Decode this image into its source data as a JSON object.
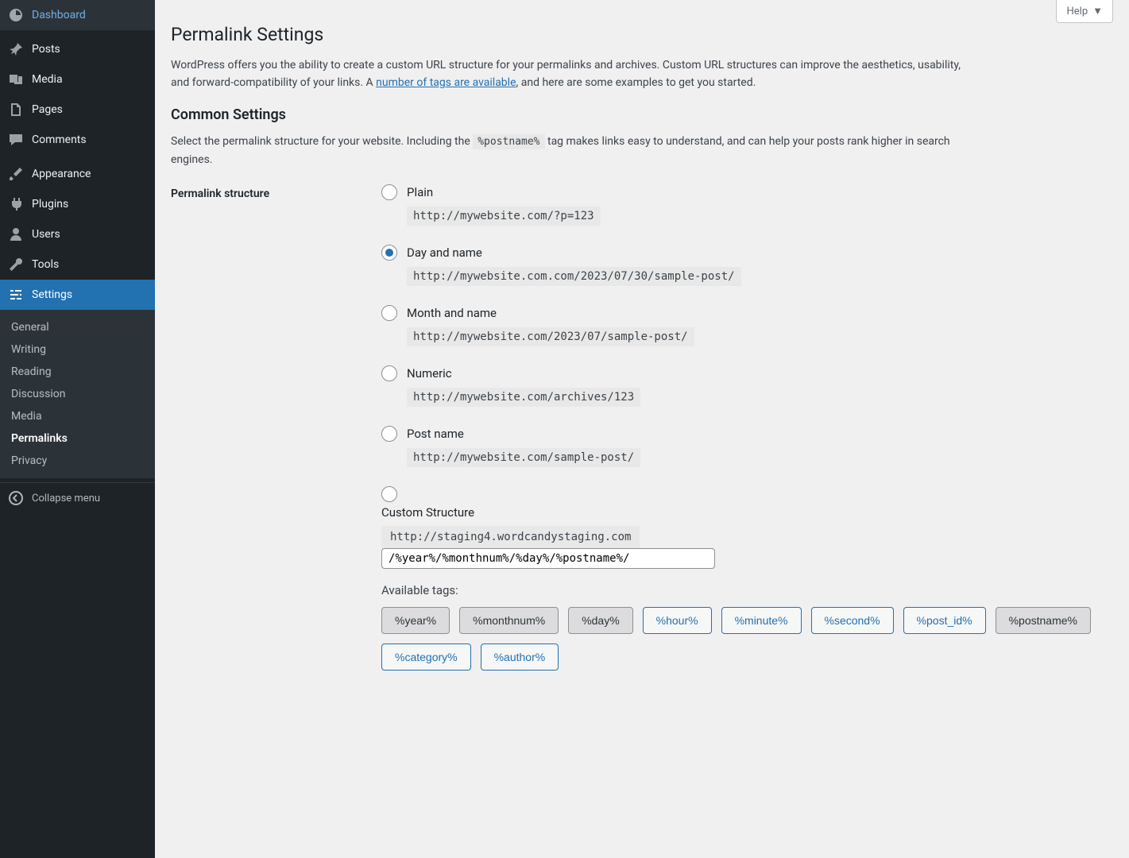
{
  "sidebar": {
    "items": [
      {
        "label": "Dashboard",
        "icon": "dashboard"
      },
      {
        "label": "Posts",
        "icon": "posts"
      },
      {
        "label": "Media",
        "icon": "media"
      },
      {
        "label": "Pages",
        "icon": "pages"
      },
      {
        "label": "Comments",
        "icon": "comments"
      },
      {
        "label": "Appearance",
        "icon": "appearance"
      },
      {
        "label": "Plugins",
        "icon": "plugins"
      },
      {
        "label": "Users",
        "icon": "users"
      },
      {
        "label": "Tools",
        "icon": "tools"
      },
      {
        "label": "Settings",
        "icon": "settings"
      }
    ],
    "submenu": [
      "General",
      "Writing",
      "Reading",
      "Discussion",
      "Media",
      "Permalinks",
      "Privacy"
    ],
    "collapse_label": "Collapse menu"
  },
  "help_label": "Help",
  "page_title": "Permalink Settings",
  "intro_pre": "WordPress offers you the ability to create a custom URL structure for your permalinks and archives. Custom URL structures can improve the aesthetics, usability, and forward-compatibility of your links. A ",
  "intro_link": "number of tags are available",
  "intro_post": ", and here are some examples to get you started.",
  "section_title": "Common Settings",
  "section_desc_pre": "Select the permalink structure for your website. Including the ",
  "section_desc_code": "%postname%",
  "section_desc_post": " tag makes links easy to understand, and can help your posts rank higher in search engines.",
  "structure_label": "Permalink structure",
  "options": [
    {
      "label": "Plain",
      "example": "http://mywebsite.com/?p=123",
      "checked": false
    },
    {
      "label": "Day and name",
      "example": "http://mywebsite.com.com/2023/07/30/sample-post/",
      "checked": true
    },
    {
      "label": "Month and name",
      "example": "http://mywebsite.com/2023/07/sample-post/",
      "checked": false
    },
    {
      "label": "Numeric",
      "example": "http://mywebsite.com/archives/123",
      "checked": false
    },
    {
      "label": "Post name",
      "example": "http://mywebsite.com/sample-post/",
      "checked": false
    }
  ],
  "custom": {
    "label": "Custom Structure",
    "prefix": "http://staging4.wordcandystaging.com",
    "value": "/%year%/%monthnum%/%day%/%postname%/"
  },
  "available_label": "Available tags:",
  "tags": [
    {
      "label": "%year%",
      "active": true
    },
    {
      "label": "%monthnum%",
      "active": true
    },
    {
      "label": "%day%",
      "active": true
    },
    {
      "label": "%hour%",
      "active": false
    },
    {
      "label": "%minute%",
      "active": false
    },
    {
      "label": "%second%",
      "active": false
    },
    {
      "label": "%post_id%",
      "active": false
    },
    {
      "label": "%postname%",
      "active": true
    },
    {
      "label": "%category%",
      "active": false
    },
    {
      "label": "%author%",
      "active": false
    }
  ]
}
